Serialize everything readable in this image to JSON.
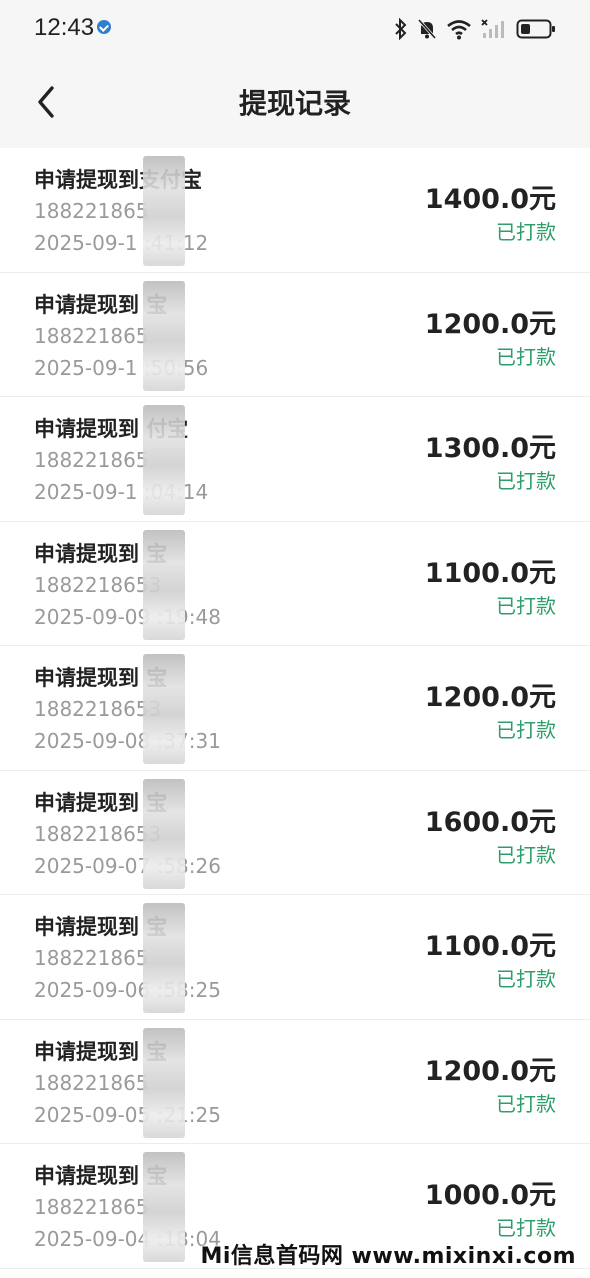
{
  "status_bar": {
    "time": "12:43",
    "icons": [
      "verified-badge-icon",
      "bluetooth-icon",
      "bell-muted-icon",
      "wifi-icon",
      "signal-off-icon",
      "battery-low-icon"
    ]
  },
  "header": {
    "back_icon": "chevron-left-icon",
    "title": "提现记录"
  },
  "records": [
    {
      "title": "申请提现到支付宝",
      "account": "188221865",
      "time": "2025-09-1  :41:12",
      "amount": "1400.0元",
      "status": "已打款"
    },
    {
      "title": "申请提现到  宝",
      "account": "188221865",
      "time": "2025-09-1  :50:56",
      "amount": "1200.0元",
      "status": "已打款"
    },
    {
      "title": "申请提现到  付宝",
      "account": "188221865",
      "time": "2025-09-1  :04:14",
      "amount": "1300.0元",
      "status": "已打款"
    },
    {
      "title": "申请提现到  宝",
      "account": "1882218653",
      "time": "2025-09-09  :19:48",
      "amount": "1100.0元",
      "status": "已打款"
    },
    {
      "title": "申请提现到  宝",
      "account": "1882218653",
      "time": "2025-09-08  :37:31",
      "amount": "1200.0元",
      "status": "已打款"
    },
    {
      "title": "申请提现到  宝",
      "account": "1882218653",
      "time": "2025-09-07  :58:26",
      "amount": "1600.0元",
      "status": "已打款"
    },
    {
      "title": "申请提现到  宝",
      "account": "188221865",
      "time": "2025-09-06  :58:25",
      "amount": "1100.0元",
      "status": "已打款"
    },
    {
      "title": "申请提现到  宝",
      "account": "188221865",
      "time": "2025-09-05  :21:25",
      "amount": "1200.0元",
      "status": "已打款"
    },
    {
      "title": "申请提现到  宝",
      "account": "188221865",
      "time": "2025-09-04  :18:04",
      "amount": "1000.0元",
      "status": "已打款"
    }
  ],
  "watermark": "Mi信息首码网 www.mixinxi.com",
  "colors": {
    "status_green": "#2e9e6a",
    "header_bg": "#f6f6f6",
    "text_dark": "#222222",
    "text_gray": "#9a9a9a"
  }
}
